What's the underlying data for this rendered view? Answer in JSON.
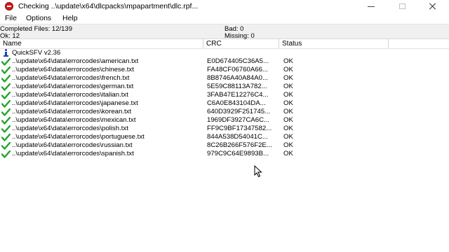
{
  "window": {
    "title": "Checking ..\\update\\x64\\dlcpacks\\mpapartment\\dlc.rpf...",
    "minimize_icon": "minimize-icon",
    "maximize_icon": "maximize-icon",
    "close_icon": "close-icon"
  },
  "menu": {
    "file": "File",
    "options": "Options",
    "help": "Help"
  },
  "status": {
    "completed": "Completed Files: 12/139",
    "ok": "Ok: 12",
    "bad": "Bad: 0",
    "missing": "Missing: 0"
  },
  "columns": {
    "name": "Name",
    "crc": "CRC",
    "status": "Status"
  },
  "header_row": {
    "label": "QuickSFV v2.36",
    "icon": "info-icon"
  },
  "files": [
    {
      "name": "..\\update\\x64\\data\\errorcodes\\american.txt",
      "crc": "E0D674405C36A5...",
      "status": "OK"
    },
    {
      "name": "..\\update\\x64\\data\\errorcodes\\chinese.txt",
      "crc": "FA48CF06760A66...",
      "status": "OK"
    },
    {
      "name": "..\\update\\x64\\data\\errorcodes\\french.txt",
      "crc": "8B8746A40A84A0...",
      "status": "OK"
    },
    {
      "name": "..\\update\\x64\\data\\errorcodes\\german.txt",
      "crc": "5E59C88113A782...",
      "status": "OK"
    },
    {
      "name": "..\\update\\x64\\data\\errorcodes\\italian.txt",
      "crc": "3FAB47E12276C4...",
      "status": "OK"
    },
    {
      "name": "..\\update\\x64\\data\\errorcodes\\japanese.txt",
      "crc": "C6A0E843104DA...",
      "status": "OK"
    },
    {
      "name": "..\\update\\x64\\data\\errorcodes\\korean.txt",
      "crc": "640D3929F251745...",
      "status": "OK"
    },
    {
      "name": "..\\update\\x64\\data\\errorcodes\\mexican.txt",
      "crc": "1969DF3927CA6C...",
      "status": "OK"
    },
    {
      "name": "..\\update\\x64\\data\\errorcodes\\polish.txt",
      "crc": "FF9C9BF17347582...",
      "status": "OK"
    },
    {
      "name": "..\\update\\x64\\data\\errorcodes\\portuguese.txt",
      "crc": "844A538D54041C...",
      "status": "OK"
    },
    {
      "name": "..\\update\\x64\\data\\errorcodes\\russian.txt",
      "crc": "8C26B266F576F2E...",
      "status": "OK"
    },
    {
      "name": "..\\update\\x64\\data\\errorcodes\\spanish.txt",
      "crc": "979C9C64E9893B...",
      "status": "OK"
    }
  ],
  "row_icon": "check-icon",
  "colors": {
    "check": "#1fa32b",
    "info": "#1e3fb0",
    "app_icon": "#d21c1c"
  }
}
